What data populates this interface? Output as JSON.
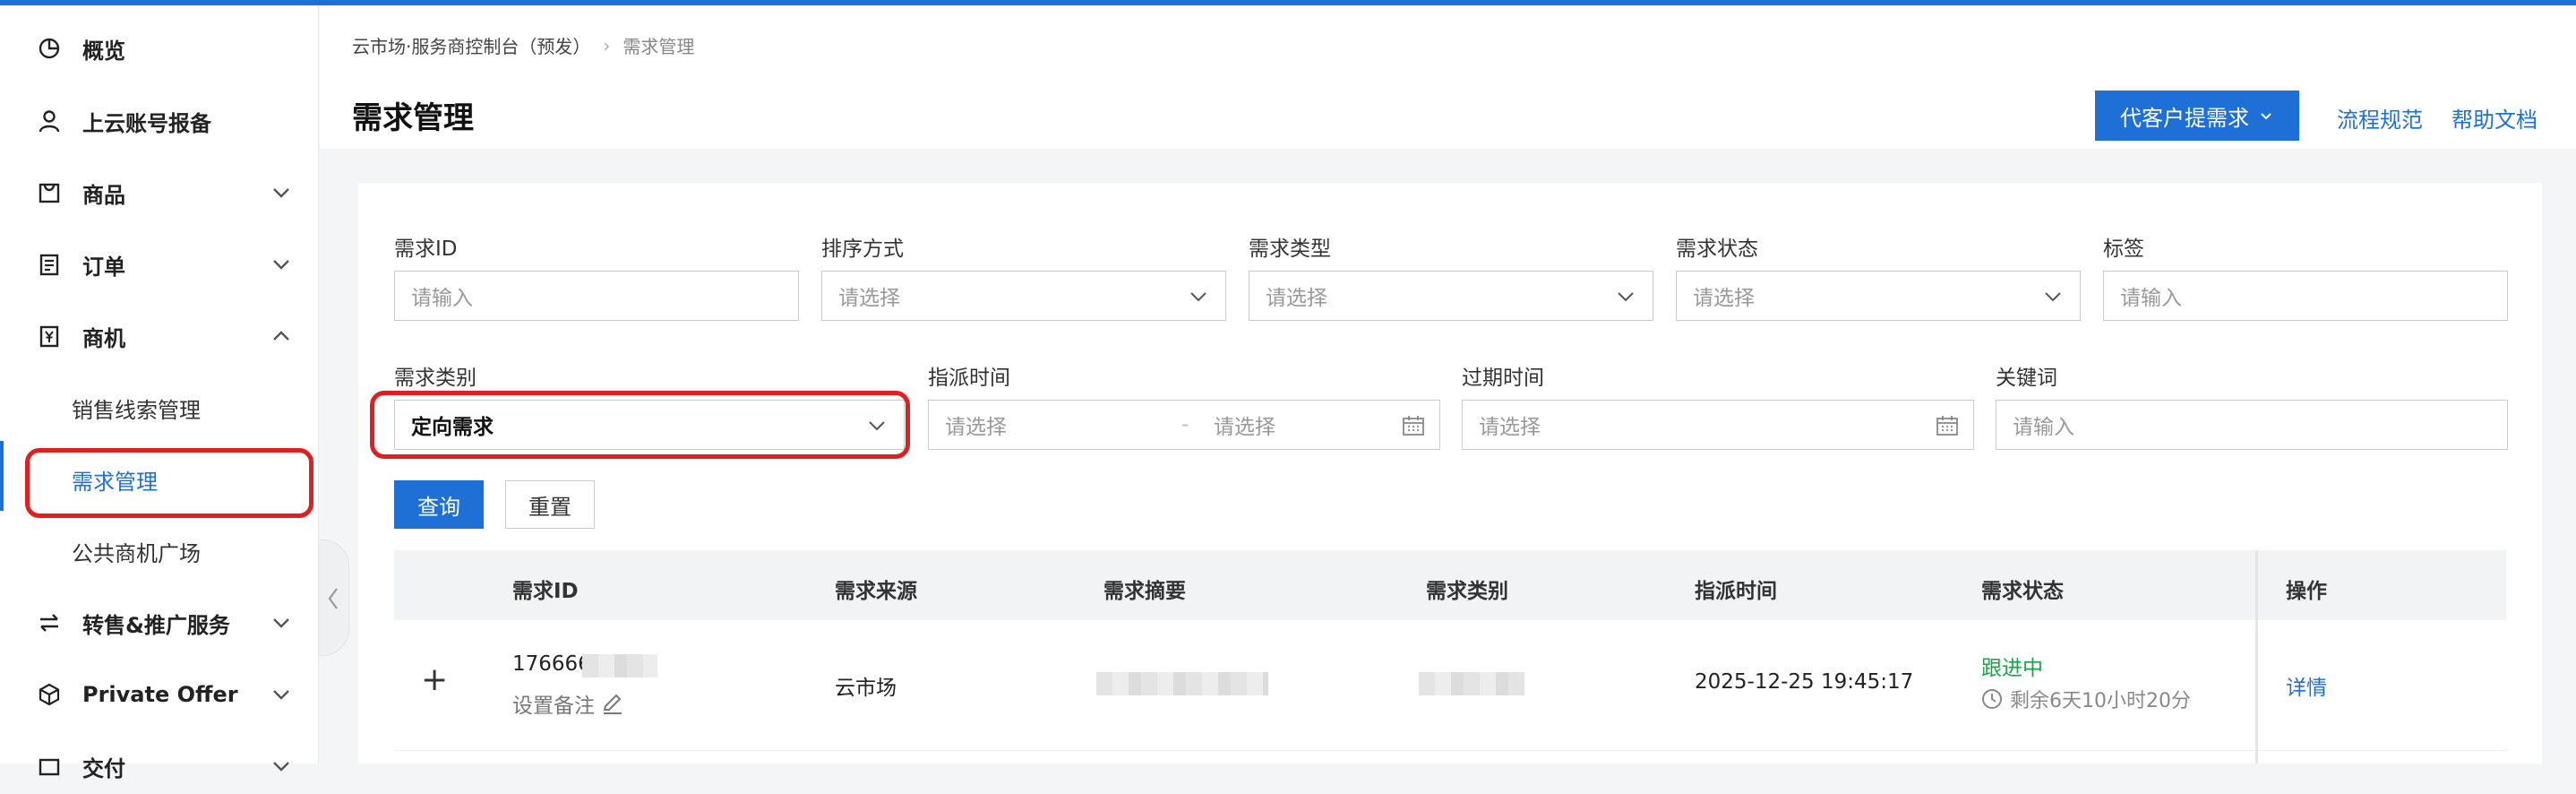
{
  "sidebar": {
    "items": [
      {
        "label": "概览",
        "icon": "pie-chart-icon"
      },
      {
        "label": "上云账号报备",
        "icon": "user-icon"
      },
      {
        "label": "商品",
        "icon": "shopping-bag-icon"
      },
      {
        "label": "订单",
        "icon": "order-list-icon"
      },
      {
        "label": "商机",
        "icon": "yen-tag-icon"
      },
      {
        "label": "转售&推广服务",
        "icon": "exchange-icon"
      },
      {
        "label": "Private Offer",
        "icon": "cube-icon"
      },
      {
        "label": "交付",
        "icon": "delivery-icon"
      }
    ],
    "sub_items": [
      {
        "label": "销售线索管理"
      },
      {
        "label": "需求管理"
      },
      {
        "label": "公共商机广场"
      }
    ]
  },
  "breadcrumb": {
    "root": "云市场·服务商控制台（预发）",
    "current": "需求管理"
  },
  "page": {
    "title": "需求管理",
    "primary_action": "代客户提需求",
    "link_process": "流程规范",
    "link_help": "帮助文档"
  },
  "filters": {
    "demand_id": {
      "label": "需求ID",
      "placeholder": "请输入"
    },
    "sort": {
      "label": "排序方式",
      "placeholder": "请选择"
    },
    "type": {
      "label": "需求类型",
      "placeholder": "请选择"
    },
    "status": {
      "label": "需求状态",
      "placeholder": "请选择"
    },
    "tag": {
      "label": "标签",
      "placeholder": "请输入"
    },
    "category": {
      "label": "需求类别",
      "value": "定向需求"
    },
    "assign_time": {
      "label": "指派时间",
      "start": "请选择",
      "sep": "-",
      "end": "请选择"
    },
    "expire_time": {
      "label": "过期时间",
      "placeholder": "请选择"
    },
    "keyword": {
      "label": "关键词",
      "placeholder": "请输入"
    },
    "query_btn": "查询",
    "reset_btn": "重置"
  },
  "table": {
    "columns": [
      "需求ID",
      "需求来源",
      "需求摘要",
      "需求类别",
      "指派时间",
      "需求状态",
      "操作"
    ],
    "rows": [
      {
        "expand": "+",
        "id": "176666",
        "remark": "设置备注",
        "source": "云市场",
        "assign_time": "2025-12-25 19:45:17",
        "status": "跟进中",
        "remaining": "剩余6天10小时20分",
        "action": "详情"
      }
    ]
  },
  "colors": {
    "accent": "#1f70d6",
    "highlight": "#e02020",
    "status_green": "#1aa34a"
  }
}
